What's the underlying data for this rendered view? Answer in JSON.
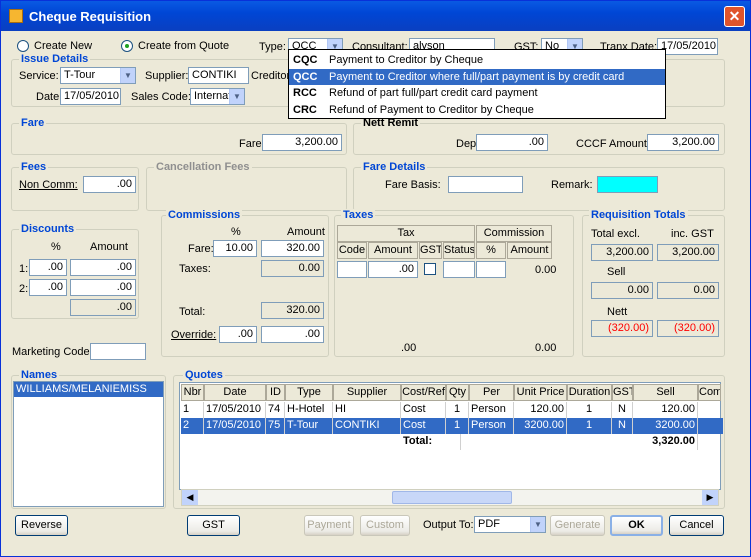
{
  "window": {
    "title": "Cheque Requisition",
    "close": "✕"
  },
  "top": {
    "create_new": "Create New",
    "create_from_quote": "Create from Quote",
    "type_label": "Type:",
    "type_value": "QCC",
    "consultant_label": "Consultant:",
    "consultant_value": "alyson",
    "gst_label": "GST:",
    "gst_value": "No",
    "tranx_label": "Tranx Date:",
    "tranx_value": "17/05/2010"
  },
  "issue": {
    "title": "Issue Details",
    "service_label": "Service:",
    "service_value": "T-Tour",
    "supplier_label": "Supplier:",
    "supplier_value": "CONTIKI",
    "creditor_label": "Creditor",
    "date_label": "Date:",
    "date_value": "17/05/2010",
    "sales_code_label": "Sales Code:",
    "sales_code_value": "Internat"
  },
  "type_dropdown": [
    {
      "code": "CQC",
      "desc": "Payment to Creditor by Cheque"
    },
    {
      "code": "QCC",
      "desc": "Payment to Creditor where full/part payment is by credit card"
    },
    {
      "code": "RCC",
      "desc": "Refund of part full/part credit card payment"
    },
    {
      "code": "CRC",
      "desc": "Refund of Payment to Creditor by Cheque"
    }
  ],
  "fare": {
    "title": "Fare",
    "label": "Fare:",
    "value": "3,200.00"
  },
  "nett": {
    "title": "Nett Remit",
    "dep_label": "Dep:",
    "dep_value": ".00",
    "cccf_label": "CCCF Amount:",
    "cccf_value": "3,200.00"
  },
  "fees": {
    "title": "Fees",
    "label": "Non Comm:",
    "value": ".00"
  },
  "cancel": {
    "title": "Cancellation Fees"
  },
  "fare_details": {
    "title": "Fare Details",
    "basis_label": "Fare Basis:",
    "basis_value": "",
    "remark_label": "Remark:",
    "remark_value": ""
  },
  "discounts": {
    "title": "Discounts",
    "pct_h": "%",
    "amt_h": "Amount",
    "row1": "1:",
    "row2": "2:",
    "d1p": ".00",
    "d1a": ".00",
    "d2p": ".00",
    "d2a": ".00",
    "total": ".00"
  },
  "commissions": {
    "title": "Commissions",
    "pct_h": "%",
    "amt_h": "Amount",
    "fare_label": "Fare:",
    "fare_pct": "10.00",
    "fare_amt": "320.00",
    "taxes_label": "Taxes:",
    "taxes_amt": "0.00",
    "total_label": "Total:",
    "total_amt": "320.00",
    "override_label": "Override:",
    "ov_pct": ".00",
    "ov_amt": ".00"
  },
  "taxes": {
    "title": "Taxes",
    "tax_h": "Tax",
    "comm_h": "Commission",
    "code_h": "Code",
    "amount_h": "Amount",
    "gst_h": "GST",
    "status_h": "Status",
    "pct_h": "%",
    "camt_h": "Amount",
    "row_amt": ".00",
    "row_camt": "0.00",
    "tot_amt": ".00",
    "tot_camt": "0.00"
  },
  "req_totals": {
    "title": "Requisition Totals",
    "excl_h": "Total excl.",
    "inc_h": "inc. GST",
    "excl": "3,200.00",
    "inc": "3,200.00",
    "sell_label": "Sell",
    "sell_excl": "0.00",
    "sell_inc": "0.00",
    "nett_label": "Nett",
    "nett_excl": "(320.00)",
    "nett_inc": "(320.00)"
  },
  "marketing": {
    "label": "Marketing Code:",
    "value": ""
  },
  "names": {
    "title": "Names",
    "items": [
      "WILLIAMS/MELANIEMISS"
    ]
  },
  "quotes": {
    "title": "Quotes",
    "headers": [
      "Nbr",
      "Date",
      "ID",
      "Type",
      "Supplier",
      "Cost/Ref",
      "Qty",
      "Per",
      "Unit Price",
      "Duration",
      "GST",
      "Sell",
      "Com"
    ],
    "rows": [
      [
        "1",
        "17/05/2010",
        "74",
        "H-Hotel",
        "HI",
        "Cost",
        "1",
        "Person",
        "120.00",
        "1",
        "N",
        "120.00"
      ],
      [
        "2",
        "17/05/2010",
        "75",
        "T-Tour",
        "CONTIKI",
        "Cost",
        "1",
        "Person",
        "3200.00",
        "1",
        "N",
        "3200.00"
      ]
    ],
    "total_label": "Total:",
    "total_value": "3,320.00"
  },
  "buttons": {
    "reverse": "Reverse",
    "gst": "GST",
    "payment": "Payment",
    "custom": "Custom",
    "output_label": "Output To:",
    "output_value": "PDF",
    "generate": "Generate",
    "ok": "OK",
    "cancel": "Cancel"
  },
  "colors": {
    "titlebar": "#0046d5",
    "selection": "#316ac5",
    "remark_bg": "#00ffff",
    "negative": "#ff0000"
  }
}
